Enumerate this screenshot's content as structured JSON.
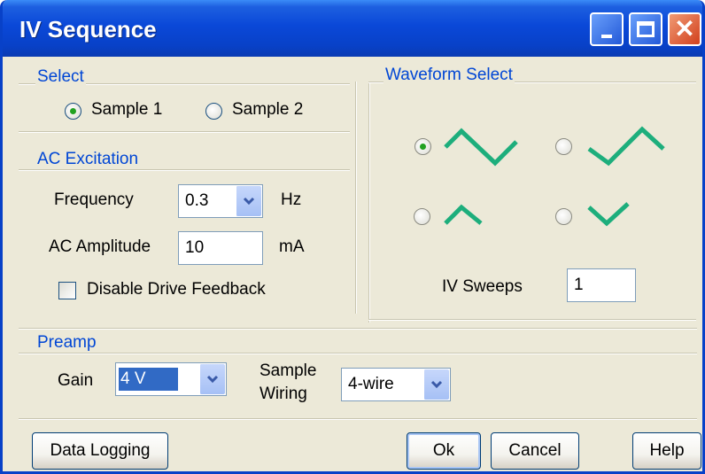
{
  "window": {
    "title": "IV Sequence"
  },
  "select": {
    "title": "Select",
    "options": [
      "Sample 1",
      "Sample 2"
    ],
    "selected": "Sample 1"
  },
  "ac_excitation": {
    "title": "AC Excitation",
    "frequency_label": "Frequency",
    "frequency_value": "0.3",
    "frequency_unit": "Hz",
    "amplitude_label": "AC Amplitude",
    "amplitude_value": "10",
    "amplitude_unit": "mA",
    "disable_feedback_label": "Disable Drive Feedback",
    "disable_feedback_checked": false
  },
  "waveform": {
    "title": "Waveform Select",
    "options": [
      "full-triangle-down-up",
      "full-triangle-up-down",
      "half-peak",
      "half-valley"
    ],
    "selected": "full-triangle-down-up",
    "sweeps_label": "IV Sweeps",
    "sweeps_value": "1",
    "accent_color": "#1dae7c"
  },
  "preamp": {
    "title": "Preamp",
    "gain_label": "Gain",
    "gain_value": "4 V",
    "wiring_label_line1": "Sample",
    "wiring_label_line2": "Wiring",
    "wiring_value": "4-wire"
  },
  "buttons": {
    "data_logging": "Data Logging",
    "ok": "Ok",
    "cancel": "Cancel",
    "help": "Help"
  }
}
